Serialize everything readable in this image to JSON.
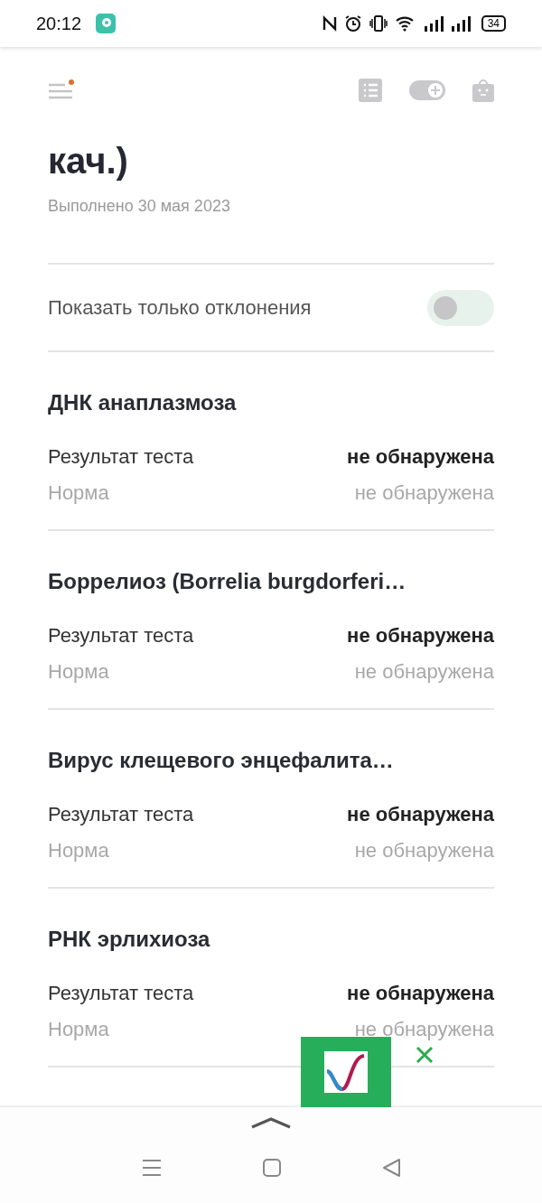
{
  "status_bar": {
    "time": "20:12",
    "battery": "34"
  },
  "header": {
    "menu_badge": true
  },
  "title": "кач.)",
  "date": "Выполнено 30 мая 2023",
  "filter": {
    "label": "Показать только отклонения",
    "on": false
  },
  "tests": [
    {
      "title": "ДНК анаплазмоза",
      "result_label": "Результат теста",
      "result_value": "не обнаружена",
      "norm_label": "Норма",
      "norm_value": "не обнаружена"
    },
    {
      "title": "Боррелиоз (Borrelia burgdorferi…",
      "result_label": "Результат теста",
      "result_value": "не обнаружена",
      "norm_label": "Норма",
      "norm_value": "не обнаружена"
    },
    {
      "title": "Вирус клещевого энцефалита…",
      "result_label": "Результат теста",
      "result_value": "не обнаружена",
      "norm_label": "Норма",
      "norm_value": "не обнаружена"
    },
    {
      "title": "РНК эрлихиоза",
      "result_label": "Результат теста",
      "result_value": "не обнаружена",
      "norm_label": "Норма",
      "norm_value": "не обнаружена"
    }
  ]
}
